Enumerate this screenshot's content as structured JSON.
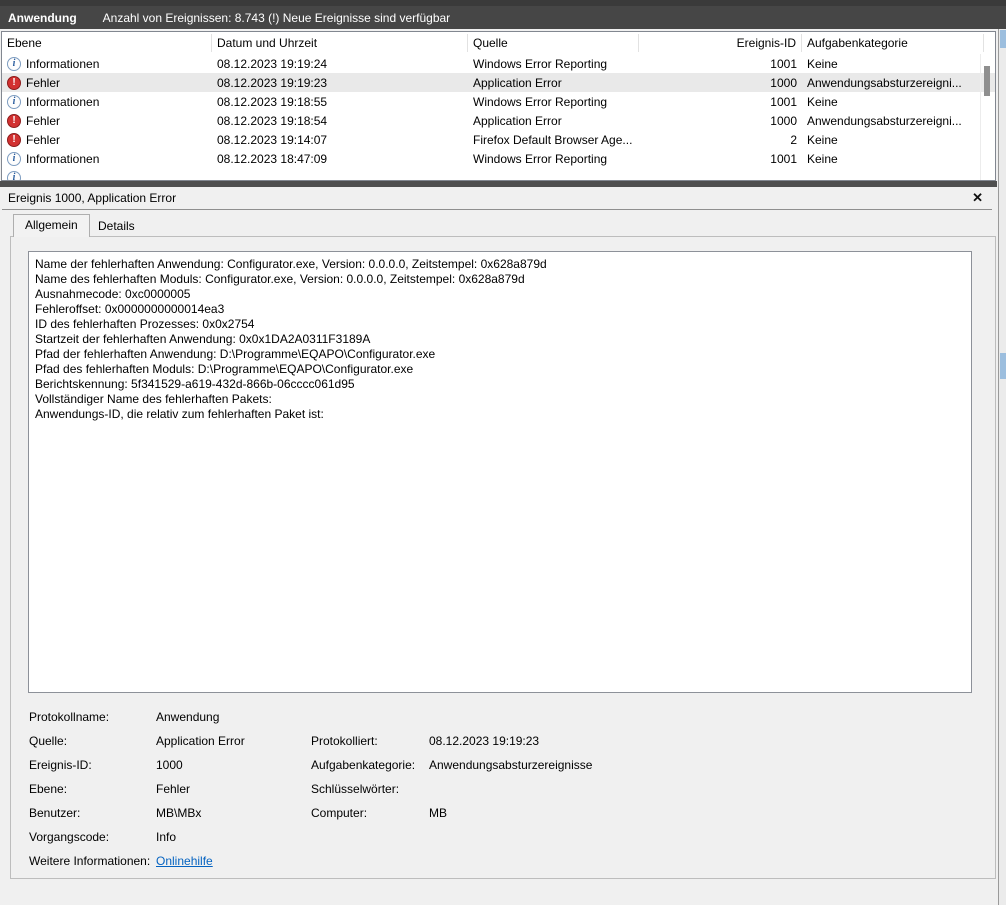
{
  "colors": {
    "titlebar_bg": "#464646",
    "selection_bg": "#e9e9e9",
    "error_red": "#d23131",
    "info_blue": "#2a5d9e",
    "link_blue": "#0563c1",
    "splitter": "#4f4f4f"
  },
  "titlebar": {
    "log_name": "Anwendung",
    "status": "Anzahl von Ereignissen: 8.743 (!) Neue Ereignisse sind verfügbar"
  },
  "table": {
    "columns": {
      "level": "Ebene",
      "datetime": "Datum und Uhrzeit",
      "source": "Quelle",
      "event_id": "Ereignis-ID",
      "category": "Aufgabenkategorie"
    },
    "rows": [
      {
        "icon": "info-icon",
        "level": "Informationen",
        "datetime": "08.12.2023 19:19:24",
        "source": "Windows Error Reporting",
        "event_id": "1001",
        "category": "Keine",
        "selected": false
      },
      {
        "icon": "error-icon",
        "level": "Fehler",
        "datetime": "08.12.2023 19:19:23",
        "source": "Application Error",
        "event_id": "1000",
        "category": "Anwendungsabsturzereigni...",
        "selected": true
      },
      {
        "icon": "info-icon",
        "level": "Informationen",
        "datetime": "08.12.2023 19:18:55",
        "source": "Windows Error Reporting",
        "event_id": "1001",
        "category": "Keine",
        "selected": false
      },
      {
        "icon": "error-icon",
        "level": "Fehler",
        "datetime": "08.12.2023 19:18:54",
        "source": "Application Error",
        "event_id": "1000",
        "category": "Anwendungsabsturzereigni...",
        "selected": false
      },
      {
        "icon": "error-icon",
        "level": "Fehler",
        "datetime": "08.12.2023 19:14:07",
        "source": "Firefox Default Browser Age...",
        "event_id": "2",
        "category": "Keine",
        "selected": false
      },
      {
        "icon": "info-icon",
        "level": "Informationen",
        "datetime": "08.12.2023 18:47:09",
        "source": "Windows Error Reporting",
        "event_id": "1001",
        "category": "Keine",
        "selected": false
      }
    ]
  },
  "detail": {
    "title": "Ereignis 1000, Application Error",
    "close_icon": "✕",
    "tabs": {
      "general": "Allgemein",
      "details": "Details"
    },
    "description_lines": [
      "Name der fehlerhaften Anwendung: Configurator.exe, Version: 0.0.0.0, Zeitstempel: 0x628a879d",
      "Name des fehlerhaften Moduls: Configurator.exe, Version: 0.0.0.0, Zeitstempel: 0x628a879d",
      "Ausnahmecode: 0xc0000005",
      "Fehleroffset: 0x0000000000014ea3",
      "ID des fehlerhaften Prozesses: 0x0x2754",
      "Startzeit der fehlerhaften Anwendung: 0x0x1DA2A0311F3189A",
      "Pfad der fehlerhaften Anwendung: D:\\Programme\\EQAPO\\Configurator.exe",
      "Pfad des fehlerhaften Moduls: D:\\Programme\\EQAPO\\Configurator.exe",
      "Berichtskennung: 5f341529-a619-432d-866b-06cccc061d95",
      "Vollständiger Name des fehlerhaften Pakets:",
      "Anwendungs-ID, die relativ zum fehlerhaften Paket ist:"
    ],
    "fields": {
      "rows": [
        {
          "l1": "Protokollname:",
          "v1": "Anwendung",
          "l2": "",
          "v2": ""
        },
        {
          "l1": "Quelle:",
          "v1": "Application Error",
          "l2": "Protokolliert:",
          "v2": "08.12.2023 19:19:23"
        },
        {
          "l1": "Ereignis-ID:",
          "v1": "1000",
          "l2": "Aufgabenkategorie:",
          "v2": "Anwendungsabsturzereignisse"
        },
        {
          "l1": "Ebene:",
          "v1": "Fehler",
          "l2": "Schlüsselwörter:",
          "v2": ""
        },
        {
          "l1": "Benutzer:",
          "v1": "MB\\MBx",
          "l2": "Computer:",
          "v2": "MB"
        },
        {
          "l1": "Vorgangscode:",
          "v1": "Info",
          "l2": "",
          "v2": ""
        },
        {
          "l1": "Weitere Informationen:",
          "v1": "Onlinehilfe",
          "l2": "",
          "v2": ""
        }
      ]
    }
  }
}
